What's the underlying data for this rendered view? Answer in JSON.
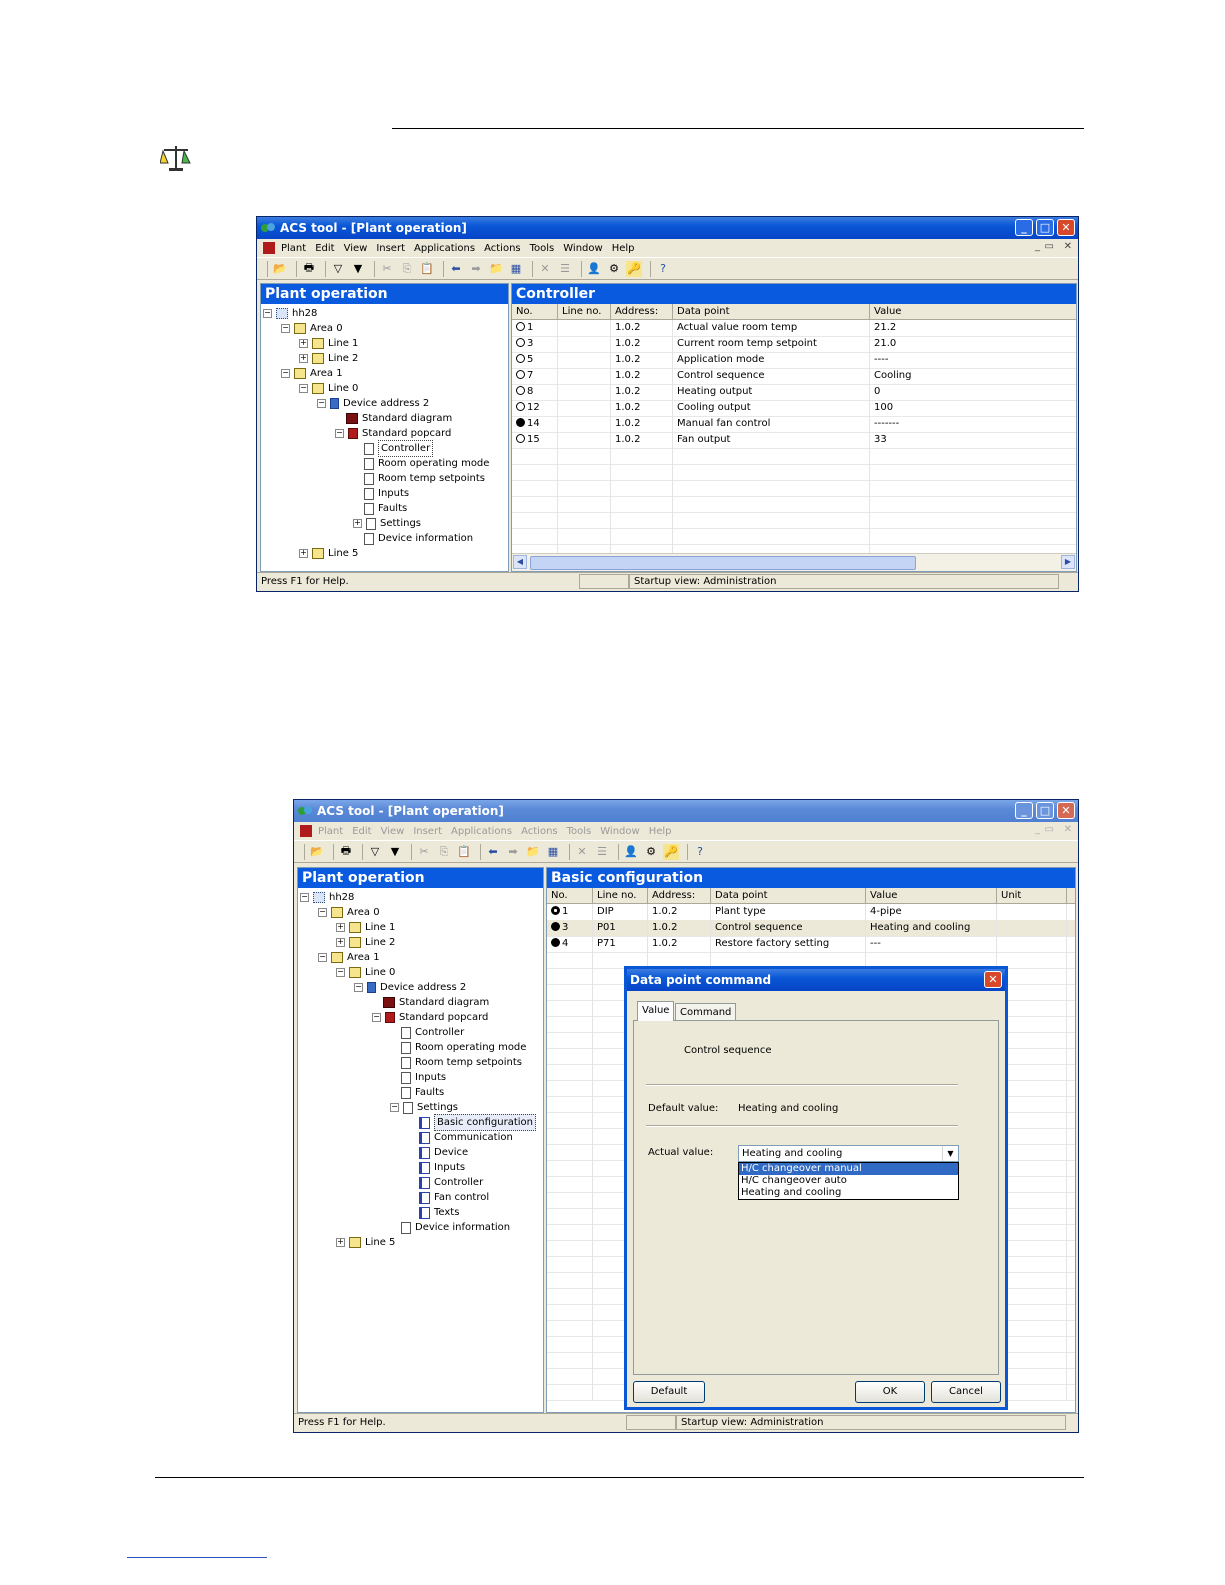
{
  "window1": {
    "title": "ACS tool - [Plant operation]",
    "menu": [
      "Plant",
      "Edit",
      "View",
      "Insert",
      "Applications",
      "Actions",
      "Tools",
      "Window",
      "Help"
    ],
    "tree_header": "Plant operation",
    "tree": [
      {
        "label": "hh28",
        "level": 0,
        "icon": "network-icon",
        "exp": "−"
      },
      {
        "label": "Area 0",
        "level": 1,
        "icon": "area-icon",
        "exp": "−"
      },
      {
        "label": "Line 1",
        "level": 2,
        "icon": "area-icon",
        "exp": "+"
      },
      {
        "label": "Line 2",
        "level": 2,
        "icon": "area-icon",
        "exp": "+"
      },
      {
        "label": "Area 1",
        "level": 1,
        "icon": "area-icon",
        "exp": "−"
      },
      {
        "label": "Line 0",
        "level": 2,
        "icon": "area-icon",
        "exp": "−"
      },
      {
        "label": "Device address 2",
        "level": 3,
        "icon": "device-icon",
        "exp": "−"
      },
      {
        "label": "Standard diagram",
        "level": 4,
        "icon": "diagram-icon",
        "exp": ""
      },
      {
        "label": "Standard popcard",
        "level": 4,
        "icon": "popcard-icon",
        "exp": "−"
      },
      {
        "label": "Controller",
        "level": 5,
        "icon": "page-icon",
        "exp": "",
        "sel": true
      },
      {
        "label": "Room operating mode",
        "level": 5,
        "icon": "page-icon",
        "exp": ""
      },
      {
        "label": "Room temp setpoints",
        "level": 5,
        "icon": "page-icon",
        "exp": ""
      },
      {
        "label": "Inputs",
        "level": 5,
        "icon": "page-icon",
        "exp": ""
      },
      {
        "label": "Faults",
        "level": 5,
        "icon": "page-icon",
        "exp": ""
      },
      {
        "label": "Settings",
        "level": 5,
        "icon": "page-icon",
        "exp": "+"
      },
      {
        "label": "Device information",
        "level": 5,
        "icon": "page-icon",
        "exp": ""
      },
      {
        "label": "Line 5",
        "level": 2,
        "icon": "area-icon",
        "exp": "+"
      }
    ],
    "grid_header": "Controller",
    "columns": [
      "No.",
      "Line no.",
      "Address:",
      "Data point",
      "Value"
    ],
    "rows": [
      {
        "no": "1",
        "line": "",
        "addr": "1.0.2",
        "dp": "Actual value room temp",
        "val": "21.2",
        "mark": "open"
      },
      {
        "no": "3",
        "line": "",
        "addr": "1.0.2",
        "dp": "Current room temp setpoint",
        "val": "21.0",
        "mark": "open"
      },
      {
        "no": "5",
        "line": "",
        "addr": "1.0.2",
        "dp": "Application mode",
        "val": "----",
        "mark": "open"
      },
      {
        "no": "7",
        "line": "",
        "addr": "1.0.2",
        "dp": "Control sequence",
        "val": "Cooling",
        "mark": "open"
      },
      {
        "no": "8",
        "line": "",
        "addr": "1.0.2",
        "dp": "Heating output",
        "val": "0",
        "mark": "open"
      },
      {
        "no": "12",
        "line": "",
        "addr": "1.0.2",
        "dp": "Cooling output",
        "val": "100",
        "mark": "open"
      },
      {
        "no": "14",
        "line": "",
        "addr": "1.0.2",
        "dp": "Manual fan control",
        "val": "-------",
        "mark": "fill"
      },
      {
        "no": "15",
        "line": "",
        "addr": "1.0.2",
        "dp": "Fan output",
        "val": "33",
        "mark": "open"
      }
    ],
    "status_help": "Press F1 for Help.",
    "status_view": "Startup view: Administration"
  },
  "window2": {
    "title": "ACS tool - [Plant operation]",
    "menu": [
      "Plant",
      "Edit",
      "View",
      "Insert",
      "Applications",
      "Actions",
      "Tools",
      "Window",
      "Help"
    ],
    "tree_header": "Plant operation",
    "tree": [
      {
        "label": "hh28",
        "level": 0,
        "icon": "network-icon",
        "exp": "−"
      },
      {
        "label": "Area 0",
        "level": 1,
        "icon": "area-icon",
        "exp": "−"
      },
      {
        "label": "Line 1",
        "level": 2,
        "icon": "area-icon",
        "exp": "+"
      },
      {
        "label": "Line 2",
        "level": 2,
        "icon": "area-icon",
        "exp": "+"
      },
      {
        "label": "Area 1",
        "level": 1,
        "icon": "area-icon",
        "exp": "−"
      },
      {
        "label": "Line 0",
        "level": 2,
        "icon": "area-icon",
        "exp": "−"
      },
      {
        "label": "Device address 2",
        "level": 3,
        "icon": "device-icon",
        "exp": "−"
      },
      {
        "label": "Standard diagram",
        "level": 4,
        "icon": "diagram-icon",
        "exp": ""
      },
      {
        "label": "Standard popcard",
        "level": 4,
        "icon": "popcard-icon",
        "exp": "−"
      },
      {
        "label": "Controller",
        "level": 5,
        "icon": "page-icon",
        "exp": ""
      },
      {
        "label": "Room operating mode",
        "level": 5,
        "icon": "page-icon",
        "exp": ""
      },
      {
        "label": "Room temp setpoints",
        "level": 5,
        "icon": "page-icon",
        "exp": ""
      },
      {
        "label": "Inputs",
        "level": 5,
        "icon": "page-icon",
        "exp": ""
      },
      {
        "label": "Faults",
        "level": 5,
        "icon": "page-icon",
        "exp": ""
      },
      {
        "label": "Settings",
        "level": 5,
        "icon": "page-icon",
        "exp": "−"
      },
      {
        "label": "Basic configuration",
        "level": 6,
        "icon": "blue-page-icon",
        "exp": "",
        "hl": true
      },
      {
        "label": "Communication",
        "level": 6,
        "icon": "blue-page-icon",
        "exp": ""
      },
      {
        "label": "Device",
        "level": 6,
        "icon": "blue-page-icon",
        "exp": ""
      },
      {
        "label": "Inputs",
        "level": 6,
        "icon": "blue-page-icon",
        "exp": ""
      },
      {
        "label": "Controller",
        "level": 6,
        "icon": "blue-page-icon",
        "exp": ""
      },
      {
        "label": "Fan control",
        "level": 6,
        "icon": "blue-page-icon",
        "exp": ""
      },
      {
        "label": "Texts",
        "level": 6,
        "icon": "blue-page-icon",
        "exp": ""
      },
      {
        "label": "Device information",
        "level": 5,
        "icon": "page-icon",
        "exp": ""
      },
      {
        "label": "Line 5",
        "level": 2,
        "icon": "area-icon",
        "exp": "+"
      }
    ],
    "grid_header": "Basic configuration",
    "columns": [
      "No.",
      "Line no.",
      "Address:",
      "Data point",
      "Value",
      "Unit"
    ],
    "rows": [
      {
        "no": "1",
        "line": "DIP",
        "addr": "1.0.2",
        "dp": "Plant type",
        "val": "4-pipe",
        "mark": "lock"
      },
      {
        "no": "3",
        "line": "P01",
        "addr": "1.0.2",
        "dp": "Control sequence",
        "val": "Heating and cooling",
        "mark": "lockfill"
      },
      {
        "no": "4",
        "line": "P71",
        "addr": "1.0.2",
        "dp": "Restore factory setting",
        "val": "---",
        "mark": "fill"
      }
    ],
    "status_help": "Press F1 for Help.",
    "status_view": "Startup view: Administration"
  },
  "dialog": {
    "title": "Data point command",
    "tabs": [
      "Value",
      "Command"
    ],
    "datapoint": "Control sequence",
    "default_label": "Default value:",
    "default_value": "Heating and cooling",
    "actual_label": "Actual value:",
    "actual_value": "Heating and cooling",
    "options": [
      "H/C changeover manual",
      "H/C changeover auto",
      "Heating and cooling"
    ],
    "buttons": {
      "default": "Default",
      "ok": "OK",
      "cancel": "Cancel"
    }
  },
  "colors": {
    "title_blue": "#0a57d6",
    "pane_header": "#0a5ae0",
    "xp_face": "#ece9d8",
    "selection": "#316ac5"
  }
}
